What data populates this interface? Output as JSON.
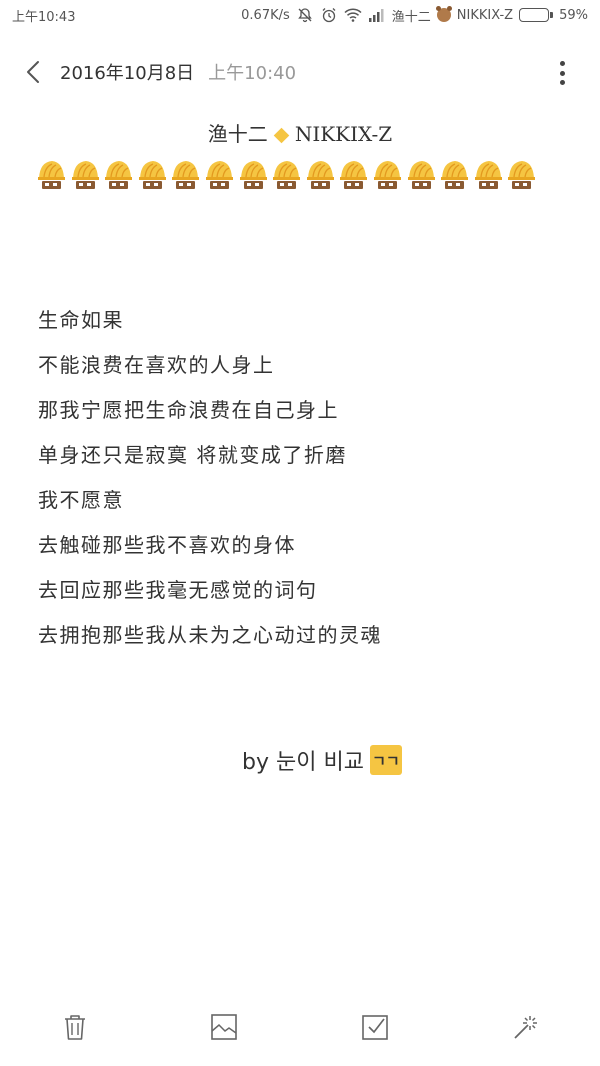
{
  "status_bar": {
    "time": "上午10:43",
    "network_speed": "0.67K/s",
    "notification_text": "渔十二",
    "notification_text2": "NIKKIX-Z",
    "battery": "59%",
    "battery_level": 0.59,
    "icons": [
      "mute-bell-icon",
      "alarm-icon",
      "wifi-icon",
      "signal-icon",
      "bear-avatar-icon",
      "battery-icon"
    ]
  },
  "header": {
    "date": "2016年10月8日",
    "time": "上午10:40",
    "icons": [
      "back-arrow-icon",
      "more-vert-icon"
    ]
  },
  "note": {
    "title_left": "渔十二",
    "title_right": "NIKKIX-Z",
    "emoji_count": 15,
    "emoji_icon": "wave-hat-emoji-icon",
    "lines": [
      "生命如果",
      "不能浪费在喜欢的人身上",
      "那我宁愿把生命浪费在自己身上",
      "单身还只是寂寞 将就变成了折磨",
      "我不愿意",
      "去触碰那些我不喜欢的身体",
      "去回应那些我毫无感觉的词句",
      "去拥抱那些我从未为之心动过的灵魂"
    ],
    "signature": "by 눈이 비교",
    "signature_badge": "ㄱㄱ"
  },
  "toolbar": {
    "icons": [
      "trash-icon",
      "image-icon",
      "checkbox-icon",
      "magic-wand-icon"
    ]
  },
  "colors": {
    "accent": "#f5c542",
    "text": "#333333",
    "muted": "#999999"
  }
}
